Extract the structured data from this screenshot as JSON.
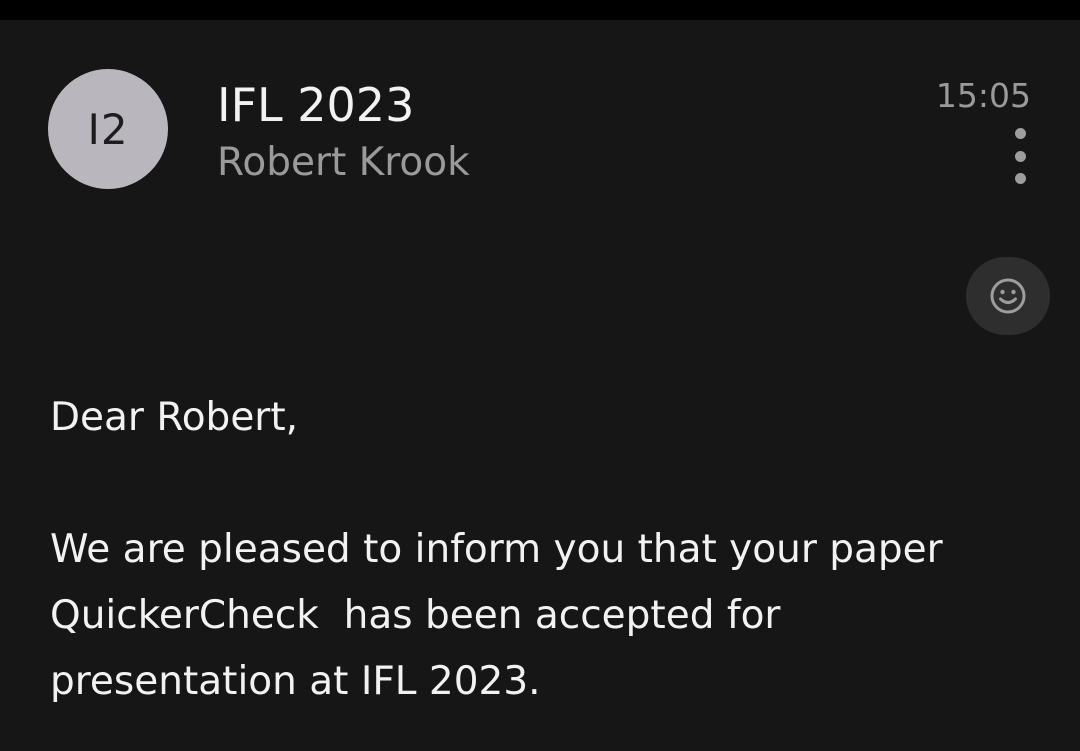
{
  "header": {
    "avatar_initials": "I2",
    "subject": "IFL 2023",
    "sender": "Robert Krook",
    "time": "15:05",
    "more_icon": "more-vertical-icon",
    "reaction_icon": "smiley-icon"
  },
  "message": {
    "greeting": "Dear Robert,",
    "lines": [
      "We are pleased to inform you that your paper",
      "QuickerCheck  has been accepted for",
      "presentation at IFL 2023."
    ]
  },
  "colors": {
    "background": "#161616",
    "avatar": "#b9b7bd",
    "primary_text": "#f2f2f2",
    "secondary_text": "#9a9a9a",
    "reaction_button": "#2e2e2e"
  }
}
